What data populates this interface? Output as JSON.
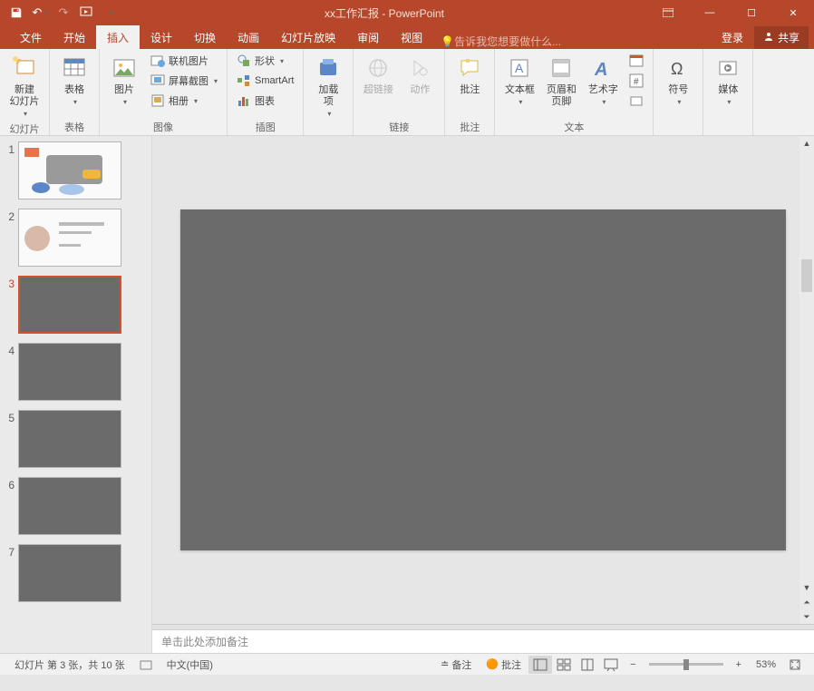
{
  "title": "xx工作汇报 - PowerPoint",
  "tabs": {
    "file": "文件",
    "home": "开始",
    "insert": "插入",
    "design": "设计",
    "transitions": "切换",
    "animations": "动画",
    "slideshow": "幻灯片放映",
    "review": "审阅",
    "view": "视图"
  },
  "tellme": "告诉我您想要做什么...",
  "login": "登录",
  "share": "共享",
  "ribbon": {
    "newSlide": "新建\n幻灯片",
    "slidesGroup": "幻灯片",
    "table": "表格",
    "tablesGroup": "表格",
    "pictures": "图片",
    "onlinePictures": "联机图片",
    "screenshot": "屏幕截图",
    "photoAlbum": "相册",
    "imagesGroup": "图像",
    "shapes": "形状",
    "smartArt": "SmartArt",
    "chart": "图表",
    "illustrationsGroup": "插图",
    "addins": "加载\n项",
    "hyperlink": "超链接",
    "action": "动作",
    "linksGroup": "链接",
    "comment": "批注",
    "commentsGroup": "批注",
    "textBox": "文本框",
    "headerFooter": "页眉和页脚",
    "wordArt": "艺术字",
    "textGroup": "文本",
    "symbol": "符号",
    "media": "媒体"
  },
  "thumbs": [
    "1",
    "2",
    "3",
    "4",
    "5",
    "6",
    "7"
  ],
  "notes": "单击此处添加备注",
  "status": {
    "slideinfo": "幻灯片 第 3 张，共 10 张",
    "lang": "中文(中国)",
    "notesBtn": "备注",
    "commentsBtn": "批注",
    "zoom": "53%"
  }
}
